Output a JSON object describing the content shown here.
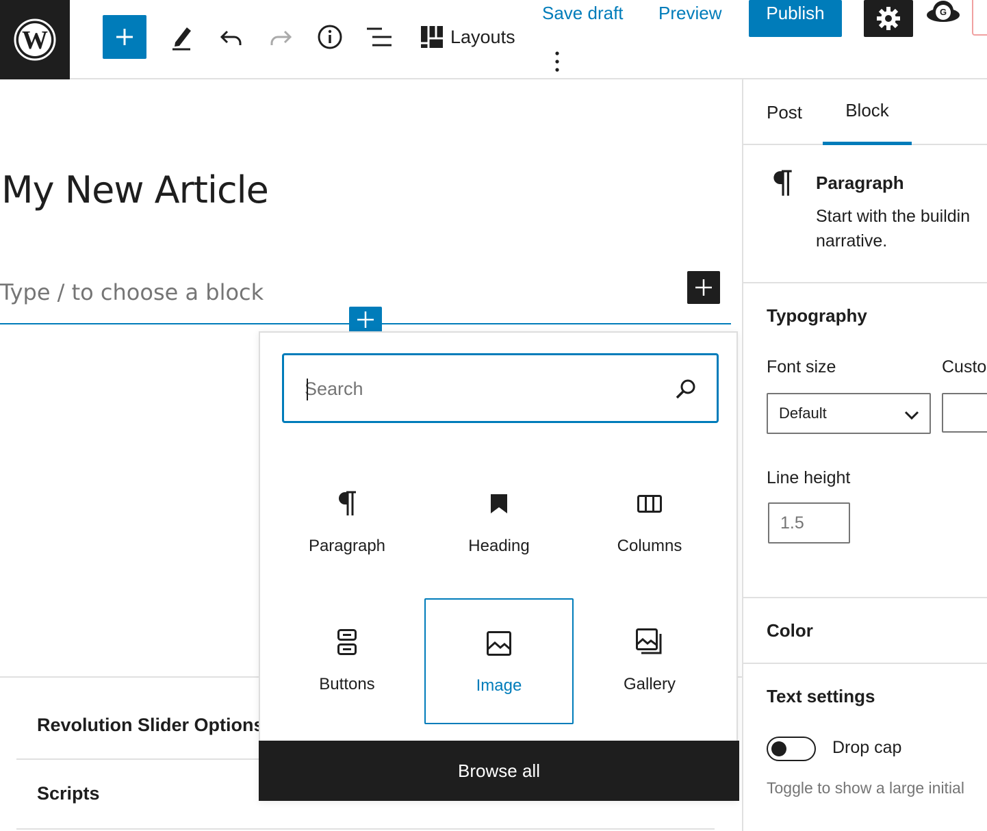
{
  "toolbar": {
    "layouts_label": "Layouts",
    "save_draft_label": "Save draft",
    "preview_label": "Preview",
    "publish_label": "Publish",
    "avatar_initial": "G"
  },
  "editor": {
    "post_title": "My New Article",
    "block_placeholder": "Type / to choose a block"
  },
  "inserter": {
    "search_placeholder": "Search",
    "blocks": [
      {
        "label": "Paragraph",
        "icon": "paragraph-icon"
      },
      {
        "label": "Heading",
        "icon": "bookmark-icon"
      },
      {
        "label": "Columns",
        "icon": "columns-icon"
      },
      {
        "label": "Buttons",
        "icon": "buttons-icon"
      },
      {
        "label": "Image",
        "icon": "image-icon",
        "selected": true
      },
      {
        "label": "Gallery",
        "icon": "gallery-icon"
      }
    ],
    "browse_all_label": "Browse all"
  },
  "meta_boxes": [
    {
      "label": "Revolution Slider Options"
    },
    {
      "label": "Scripts"
    }
  ],
  "sidebar": {
    "tabs": [
      {
        "label": "Post"
      },
      {
        "label": "Block",
        "active": true
      }
    ],
    "block_card": {
      "title": "Paragraph",
      "description_line1": "Start with the buildin",
      "description_line2": "narrative."
    },
    "typography": {
      "title": "Typography",
      "font_size_label": "Font size",
      "custom_label": "Custo",
      "font_size_value": "Default",
      "line_height_label": "Line height",
      "line_height_placeholder": "1.5"
    },
    "color_title": "Color",
    "text_settings": {
      "title": "Text settings",
      "drop_cap_label": "Drop cap",
      "drop_cap_enabled": false,
      "help_text": "Toggle to show a large initial"
    }
  },
  "colors": {
    "accent": "#007cba",
    "dark": "#1e1e1e",
    "muted": "#757575",
    "border": "#e0e0e0"
  }
}
